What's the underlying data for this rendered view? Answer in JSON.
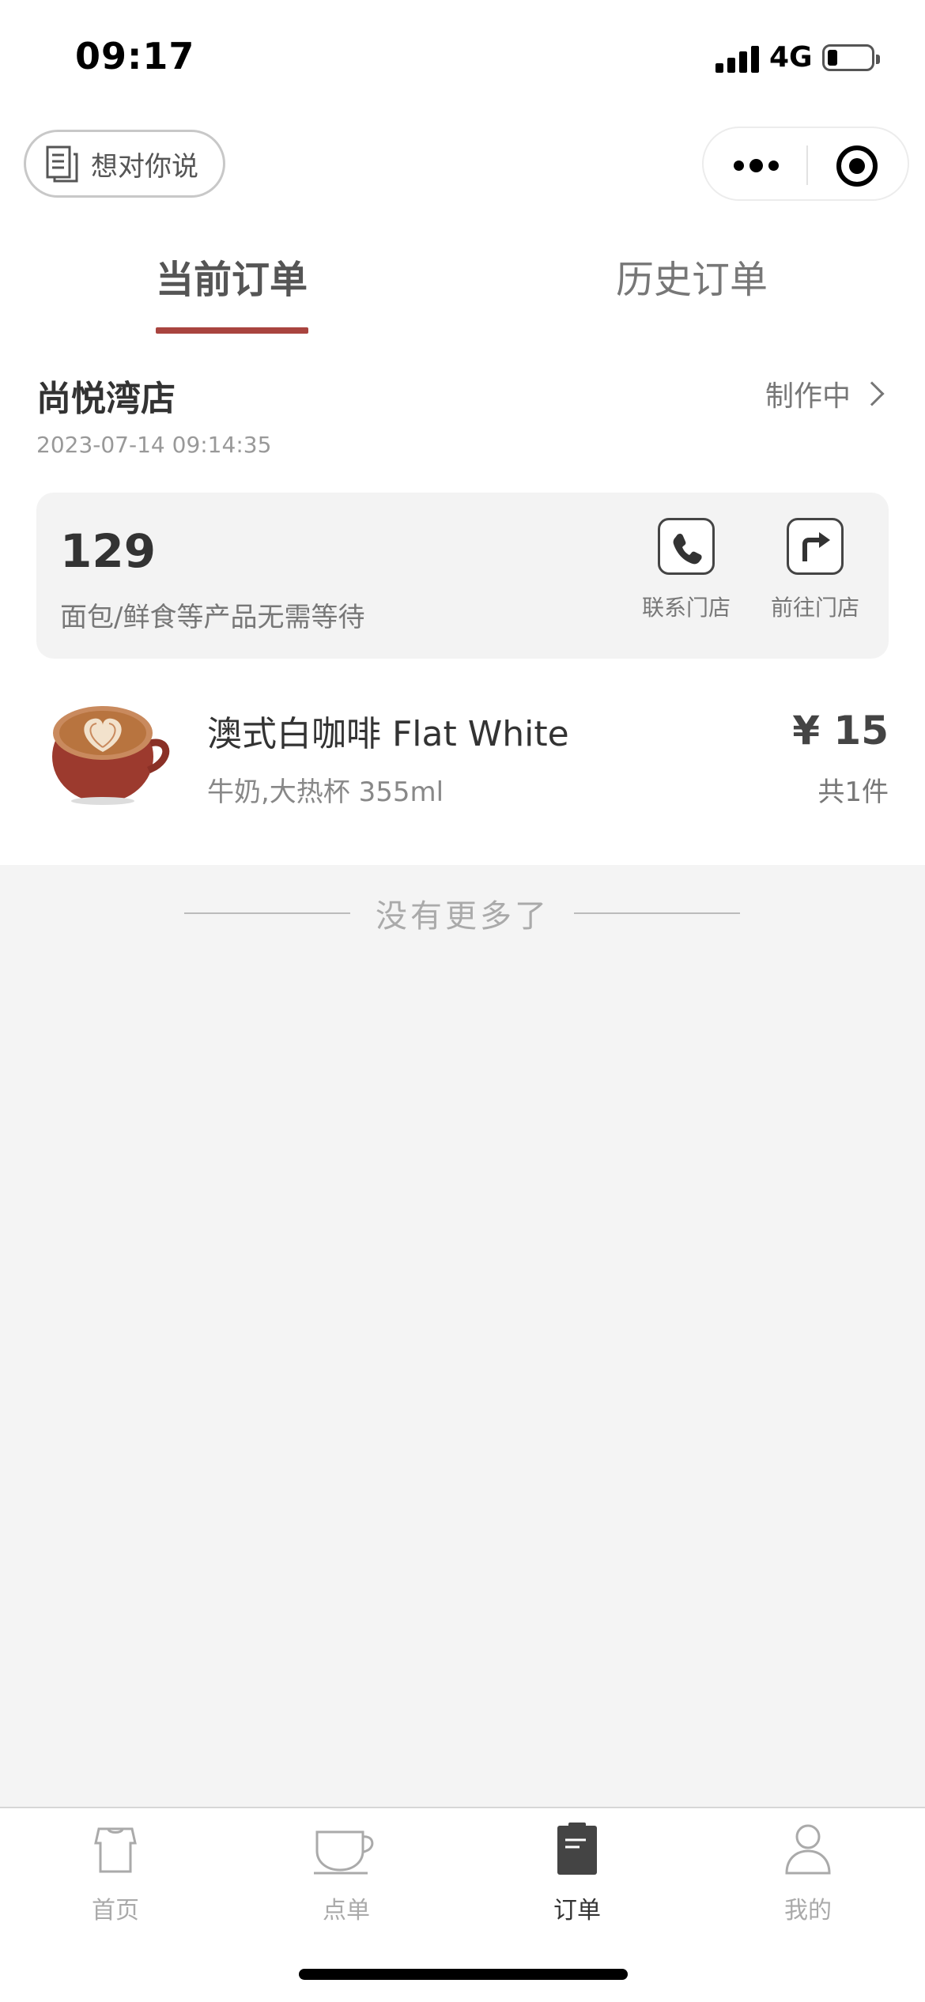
{
  "status_bar": {
    "time": "09:17",
    "network": "4G"
  },
  "header": {
    "feedback_label": "想对你说"
  },
  "tabs": [
    {
      "label": "当前订单",
      "active": true
    },
    {
      "label": "历史订单",
      "active": false
    }
  ],
  "order": {
    "store_name": "尚悦湾店",
    "time": "2023-07-14 09:14:35",
    "status": "制作中",
    "pickup_code": "129",
    "pickup_note": "面包/鲜食等产品无需等待",
    "actions": [
      {
        "label": "联系门店",
        "icon": "phone-icon"
      },
      {
        "label": "前往门店",
        "icon": "directions-icon"
      }
    ],
    "item": {
      "name": "澳式白咖啡 Flat White",
      "spec": "牛奶,大热杯 355ml",
      "price": "¥ 15",
      "qty": "共1件"
    }
  },
  "list_end_text": "没有更多了",
  "nav": [
    {
      "label": "首页",
      "icon": "shirt-icon",
      "active": false
    },
    {
      "label": "点单",
      "icon": "cup-icon",
      "active": false
    },
    {
      "label": "订单",
      "icon": "clipboard-icon",
      "active": true
    },
    {
      "label": "我的",
      "icon": "person-icon",
      "active": false
    }
  ],
  "colors": {
    "accent": "#a9443f",
    "background": "#f4f4f4",
    "card": "#f3f3f3"
  }
}
